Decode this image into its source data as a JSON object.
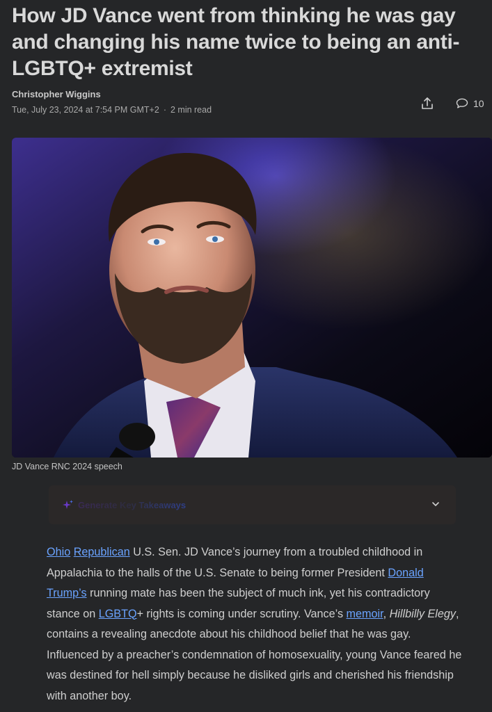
{
  "article": {
    "headline": "How JD Vance went from thinking he was gay and changing his name twice to being an anti-LGBTQ+ extremist",
    "author": "Christopher Wiggins",
    "date": "Tue, July 23, 2024 at 7:54 PM GMT+2",
    "separator": "·",
    "read_time": "2 min read",
    "comment_count": "10",
    "image_caption": "JD Vance RNC 2024 speech"
  },
  "takeaways": {
    "label": "Generate Key Takeaways"
  },
  "body": {
    "link_ohio": "Ohio",
    "link_republican": "Republican",
    "t1": " U.S. Sen. JD Vance’s journey from a troubled childhood in Appalachia to the halls of the U.S. Senate to being former President ",
    "link_trump": "Donald Trump’s",
    "t2": " running mate has been the subject of much ink, yet his contradictory stance on ",
    "link_lgbtq": "LGBTQ",
    "t3": "+ rights is coming under scrutiny. Vance’s ",
    "link_memoir": "memoir",
    "t4": ", ",
    "book_title": "Hillbilly Elegy",
    "t5": ", contains a revealing anecdote about his childhood belief that he was gay. Influenced by a preacher’s condemnation of homosexuality, young Vance feared he was destined for hell simply because he disliked girls and cherished his friendship with another boy."
  },
  "colors": {
    "background": "#252628",
    "link": "#6aa3ff"
  },
  "icons": {
    "share": "share-icon",
    "comment": "comment-icon",
    "sparkle": "sparkle-icon",
    "chevron": "chevron-down-icon"
  }
}
